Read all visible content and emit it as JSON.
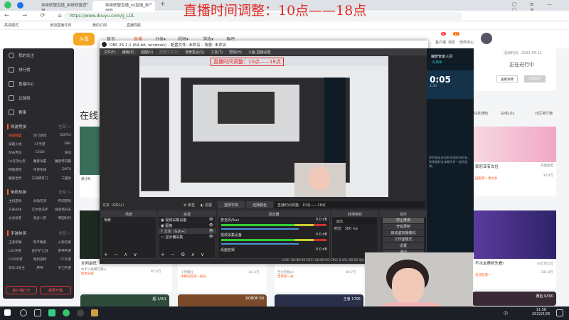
{
  "overlay_title": "直播时间调整：10点——18点",
  "browser": {
    "tabs": [
      {
        "label": "英雄联盟直播_英雄联盟直播"
      },
      {
        "label": "英雄联盟直播_lol直播_英雄联"
      }
    ],
    "url": "https://www.douyu.com/g_LOL",
    "bookmarks": [
      "高清模式",
      "添加直播订阅",
      "我的订阅",
      "直播导航"
    ]
  },
  "header": {
    "nav": [
      "首页",
      "直播",
      "分类▾",
      "视频▾",
      "游戏▾",
      "鱼吧"
    ],
    "icons": [
      "客户端",
      "消息",
      "创作中心"
    ],
    "badges": [
      "9",
      "17"
    ]
  },
  "sidebar": {
    "items": [
      "我的关注",
      "排行榜",
      "鱼塘中心",
      "云游戏",
      "赛事"
    ],
    "sections": [
      {
        "title": "网游竞技",
        "more": "全部 >",
        "games": [
          "英雄联盟",
          "热门游戏",
          "DOTA2",
          "穿越火线",
          "CF手游",
          "DNF",
          "炉石传说",
          "CSGO",
          "逆战",
          "lol云顶之弈",
          "魔兽争霸",
          "魔兽怀旧服",
          "网络游戏",
          "守望先锋",
          "DOTA",
          "魔兽世界",
          "天涯明月刀",
          "三国杀"
        ]
      },
      {
        "title": "单机热游",
        "more": "全部 >",
        "games": [
          "主机游戏",
          "永劫无间",
          "怀旧游戏",
          "方舟ARK",
          "艾尔登法环",
          "逃离塔科夫",
          "太吾绘卷",
          "鬼谷八荒",
          "帝国时代"
        ]
      },
      {
        "title": "手游休闲",
        "more": "全部 >",
        "games": [
          "王者荣耀",
          "和平精英",
          "火影忍者",
          "LOL手游",
          "金铲铲之战",
          "原神手游",
          "COD手游",
          "哈利波特",
          "CF手游",
          "欢乐斗地主",
          "原神",
          "天刀手游"
        ]
      }
    ],
    "buttons": [
      "客户端打开",
      "我要开播"
    ]
  },
  "main": {
    "section_title": "在线",
    "cards": [
      {
        "title": "余小C",
        "tag": "2022"
      },
      {
        "title": "全网最低",
        "author": "中单人被爆在我心",
        "heat": "81.6万",
        "tag": "版本先锋"
      },
      {
        "author": "十月枫丘",
        "heat": "81.3万",
        "tag": "中路同段第一船长"
      },
      {
        "author": "至大的杨sir",
        "heat": "88.7万",
        "tag": "世界第一劫"
      }
    ],
    "bottom_badges": [
      "超 1/0/1",
      "ROBOP 60",
      "王者 1705"
    ]
  },
  "event": {
    "time": "活动时间：2022-05-11",
    "status": "正在进行中",
    "buttons": [
      "查看详情",
      "立即前往"
    ]
  },
  "links": [
    "任务通知",
    "在线LOL",
    "分区排行榜"
  ],
  "right_cards": [
    {
      "title": "家尼亚有车位",
      "category": "英雄联盟",
      "heat": "34.4万",
      "tag": "国服第一瑞文女"
    },
    {
      "title": "不水友赛抢先看!",
      "category": "lol云顶之弈",
      "heat": "101.4万",
      "tag": "云顶陪第一",
      "badge": "赛后 0/0/0"
    }
  ],
  "floatapp": {
    "name": "蝴梦管家人间",
    "status": "队列中",
    "timer": "0:05",
    "sub": "2:45",
    "desc": "你的室友还没有添加任何好友，快邀请好友来聊天并一起玩游戏。"
  },
  "obs": {
    "title": "OBS 26.1.1 (64-bit, windows) - 配置文件: 未命名 - 场景: 未命名",
    "menu": [
      "文件(F)",
      "编辑(E)",
      "视图(V)",
      "配置文件(P)",
      "场景集合(S)",
      "工具(T)",
      "帮助(H)",
      "斗鱼-直播设置"
    ],
    "source_label": "文本（GDI+）",
    "props": "属性",
    "filters": "滤镜",
    "btn_font": "选择字体",
    "btn_color": "选择颜色",
    "text_value": "直播时间调整：10点——18点",
    "docks": {
      "scenes": "场景",
      "sources": "来源",
      "mixer": "混音器",
      "transitions": "转场特效",
      "controls": "控件"
    },
    "scene_items": [
      "场景"
    ],
    "source_items": [
      "视频采集设备",
      "图像",
      "文本（GDI+）",
      "显示器采集"
    ],
    "mixer": [
      {
        "name": "麦克风/Aux",
        "db": "0.0 dB"
      },
      {
        "name": "视频采集设备",
        "db": "0.0 dB"
      },
      {
        "name": "桌面音频",
        "db": "0.0 dB"
      }
    ],
    "transition": "淡出",
    "duration_label": "时长",
    "duration": "300 ms",
    "controls": [
      "停止推流",
      "开始录制",
      "启动虚拟摄像机",
      "工作室模式",
      "设置",
      "退出"
    ],
    "status": "LIVE: 00:00:00   REC: 00:00:00   CPU: 2.4%, 60.00 fps"
  },
  "taskbar": {
    "time": "11:58",
    "date": "2022/5/25",
    "ime": "中"
  }
}
